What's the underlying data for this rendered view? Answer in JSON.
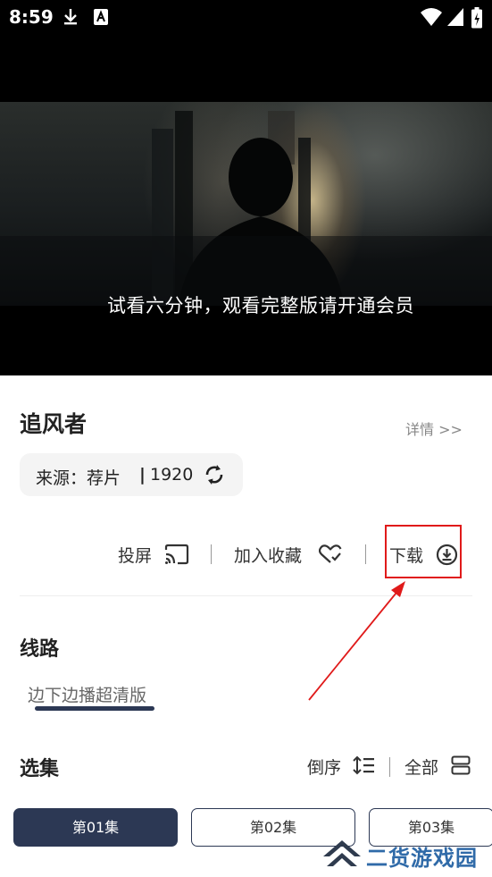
{
  "status_bar": {
    "time": "8:59"
  },
  "video": {
    "subtitle": "试看六分钟，观看完整版请开通会员"
  },
  "show": {
    "title": "追风者",
    "detail_link": "详情 >>"
  },
  "source": {
    "label": "来源：荐片",
    "separator": "|",
    "value": "1920"
  },
  "actions": {
    "cast": "投屏",
    "favorite": "加入收藏",
    "download": "下载"
  },
  "routes": {
    "title": "线路",
    "items": [
      "边下边播超清版"
    ]
  },
  "episodes": {
    "title": "选集",
    "order_label": "倒序",
    "all_label": "全部",
    "items": [
      "第01集",
      "第02集",
      "第03集"
    ]
  },
  "watermark": {
    "text": "二货游戏园"
  },
  "colors": {
    "accent": "#2c3854",
    "highlight": "#e01a1a",
    "annotation": "#e01a1a",
    "watermark": "#2f6aa8"
  }
}
